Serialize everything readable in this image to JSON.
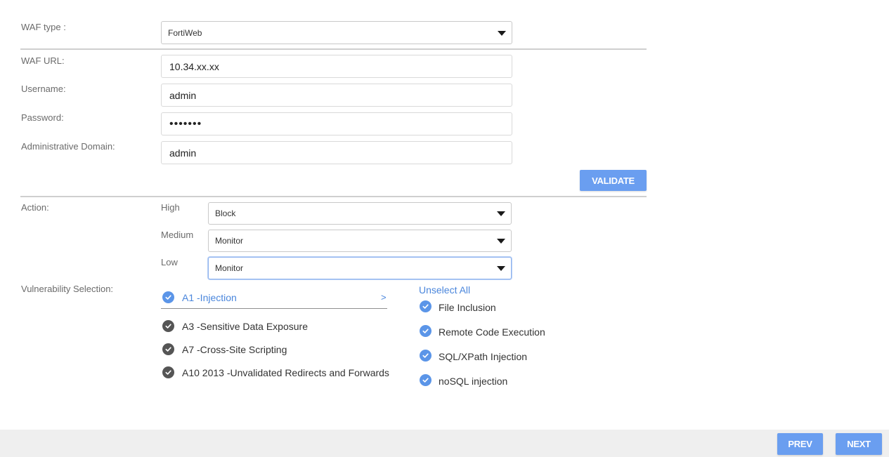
{
  "waf": {
    "type_label": "WAF type :",
    "type_value": "FortiWeb",
    "url_label": "WAF URL:",
    "url_value": "10.34.xx.xx",
    "username_label": "Username:",
    "username_value": "admin",
    "password_label": "Password:",
    "password_value": "•••••••",
    "domain_label": "Administrative Domain:",
    "domain_value": "admin",
    "validate_label": "VALIDATE"
  },
  "action": {
    "label": "Action:",
    "high_label": "High",
    "high_value": "Block",
    "medium_label": "Medium",
    "medium_value": "Monitor",
    "low_label": "Low",
    "low_value": "Monitor"
  },
  "vulnerability": {
    "label": "Vulnerability Selection:",
    "unselect_all": "Unselect All",
    "categories": [
      {
        "label": "A1 -Injection",
        "arrow": ">",
        "selected": true
      },
      {
        "label": "A3 -Sensitive Data Exposure",
        "selected": false
      },
      {
        "label": "A7 -Cross-Site Scripting",
        "selected": false
      },
      {
        "label": "A10 2013 -Unvalidated Redirects and Forwards",
        "selected": false
      }
    ],
    "subitems": [
      {
        "label": "File Inclusion",
        "checked": true
      },
      {
        "label": "Remote Code Execution",
        "checked": true
      },
      {
        "label": "SQL/XPath Injection",
        "checked": true
      },
      {
        "label": "noSQL injection",
        "checked": true
      }
    ]
  },
  "footer": {
    "prev_label": "PREV",
    "next_label": "NEXT"
  },
  "colors": {
    "accent": "#6a9ef0",
    "check_blue": "#5b95e8",
    "check_gray": "#555555",
    "active_text": "#4a86dc"
  }
}
